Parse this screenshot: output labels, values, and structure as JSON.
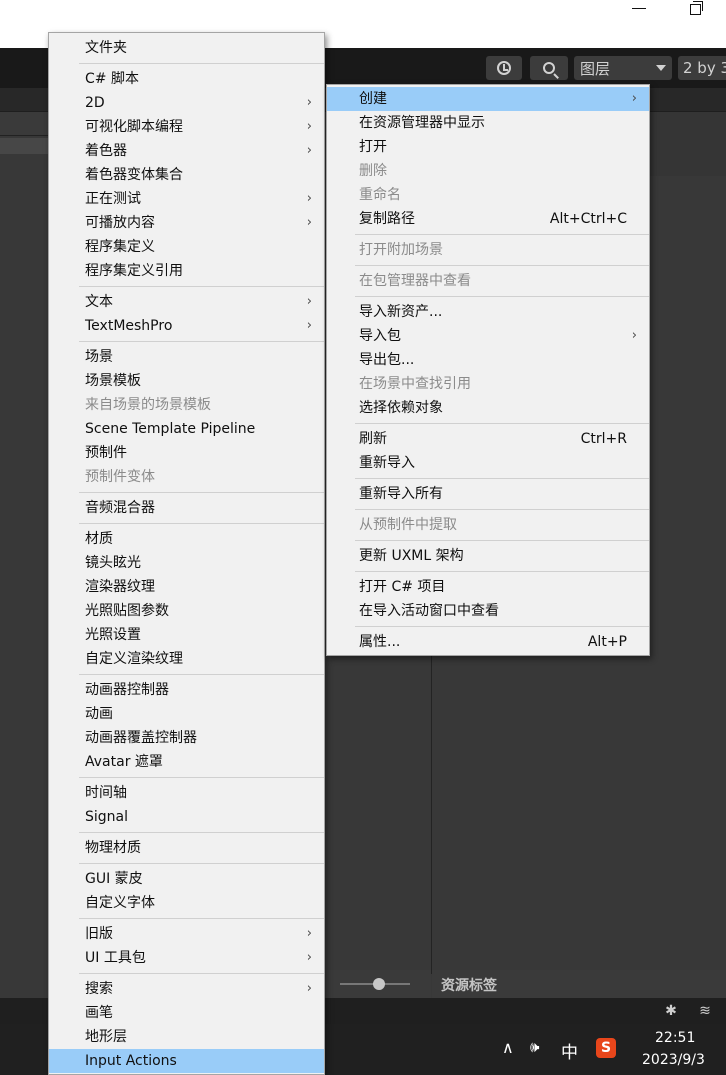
{
  "toolbar": {
    "history_icon": "history-icon",
    "search_icon": "search-icon",
    "layers_label": "图层",
    "layout_label": "2 by 3"
  },
  "background": {
    "asset_labels_title": "资源标签"
  },
  "left_menu": {
    "groups": [
      [
        {
          "label": "文件夹"
        }
      ],
      [
        {
          "label": "C# 脚本"
        },
        {
          "label": "2D",
          "submenu": true
        },
        {
          "label": "可视化脚本编程",
          "submenu": true
        },
        {
          "label": "着色器",
          "submenu": true
        },
        {
          "label": "着色器变体集合"
        },
        {
          "label": "正在测试",
          "submenu": true
        },
        {
          "label": "可播放内容",
          "submenu": true
        },
        {
          "label": "程序集定义"
        },
        {
          "label": "程序集定义引用"
        }
      ],
      [
        {
          "label": "文本",
          "submenu": true
        },
        {
          "label": "TextMeshPro",
          "submenu": true
        }
      ],
      [
        {
          "label": "场景"
        },
        {
          "label": "场景模板"
        },
        {
          "label": "来自场景的场景模板",
          "disabled": true
        },
        {
          "label": "Scene Template Pipeline"
        },
        {
          "label": "预制件"
        },
        {
          "label": "预制件变体",
          "disabled": true
        }
      ],
      [
        {
          "label": "音频混合器"
        }
      ],
      [
        {
          "label": "材质"
        },
        {
          "label": "镜头眩光"
        },
        {
          "label": "渲染器纹理"
        },
        {
          "label": "光照贴图参数"
        },
        {
          "label": "光照设置"
        },
        {
          "label": "自定义渲染纹理"
        }
      ],
      [
        {
          "label": "动画器控制器"
        },
        {
          "label": "动画"
        },
        {
          "label": "动画器覆盖控制器"
        },
        {
          "label": "Avatar 遮罩"
        }
      ],
      [
        {
          "label": "时间轴"
        },
        {
          "label": "Signal"
        }
      ],
      [
        {
          "label": "物理材质"
        }
      ],
      [
        {
          "label": "GUI 蒙皮"
        },
        {
          "label": "自定义字体"
        }
      ],
      [
        {
          "label": "旧版",
          "submenu": true
        },
        {
          "label": "UI 工具包",
          "submenu": true
        }
      ],
      [
        {
          "label": "搜索",
          "submenu": true
        },
        {
          "label": "画笔"
        },
        {
          "label": "地形层"
        },
        {
          "label": "Input Actions",
          "highlighted": true
        }
      ]
    ]
  },
  "right_menu": {
    "groups": [
      [
        {
          "label": "创建",
          "submenu": true,
          "highlighted": true
        },
        {
          "label": "在资源管理器中显示"
        },
        {
          "label": "打开"
        },
        {
          "label": "删除",
          "disabled": true
        },
        {
          "label": "重命名",
          "disabled": true
        },
        {
          "label": "复制路径",
          "shortcut": "Alt+Ctrl+C"
        }
      ],
      [
        {
          "label": "打开附加场景",
          "disabled": true
        }
      ],
      [
        {
          "label": "在包管理器中查看",
          "disabled": true
        }
      ],
      [
        {
          "label": "导入新资产..."
        },
        {
          "label": "导入包",
          "submenu": true
        },
        {
          "label": "导出包..."
        },
        {
          "label": "在场景中查找引用",
          "disabled": true
        },
        {
          "label": "选择依赖对象"
        }
      ],
      [
        {
          "label": "刷新",
          "shortcut": "Ctrl+R"
        },
        {
          "label": "重新导入"
        }
      ],
      [
        {
          "label": "重新导入所有"
        }
      ],
      [
        {
          "label": "从预制件中提取",
          "disabled": true
        }
      ],
      [
        {
          "label": "更新 UXML 架构"
        }
      ],
      [
        {
          "label": "打开 C# 项目"
        },
        {
          "label": "在导入活动窗口中查看"
        }
      ],
      [
        {
          "label": "属性...",
          "shortcut": "Alt+P"
        }
      ]
    ]
  },
  "taskbar": {
    "tray_chevron": "∧",
    "volume_icon": "volume-icon",
    "ime_label": "中",
    "sogou_label": "S",
    "time": "22:51",
    "date": "2023/9/3"
  },
  "colors": {
    "menu_bg": "#f1f1f1",
    "highlight": "#99ccf8",
    "disabled_text": "#8b8b8b",
    "editor_bg": "#383838"
  }
}
